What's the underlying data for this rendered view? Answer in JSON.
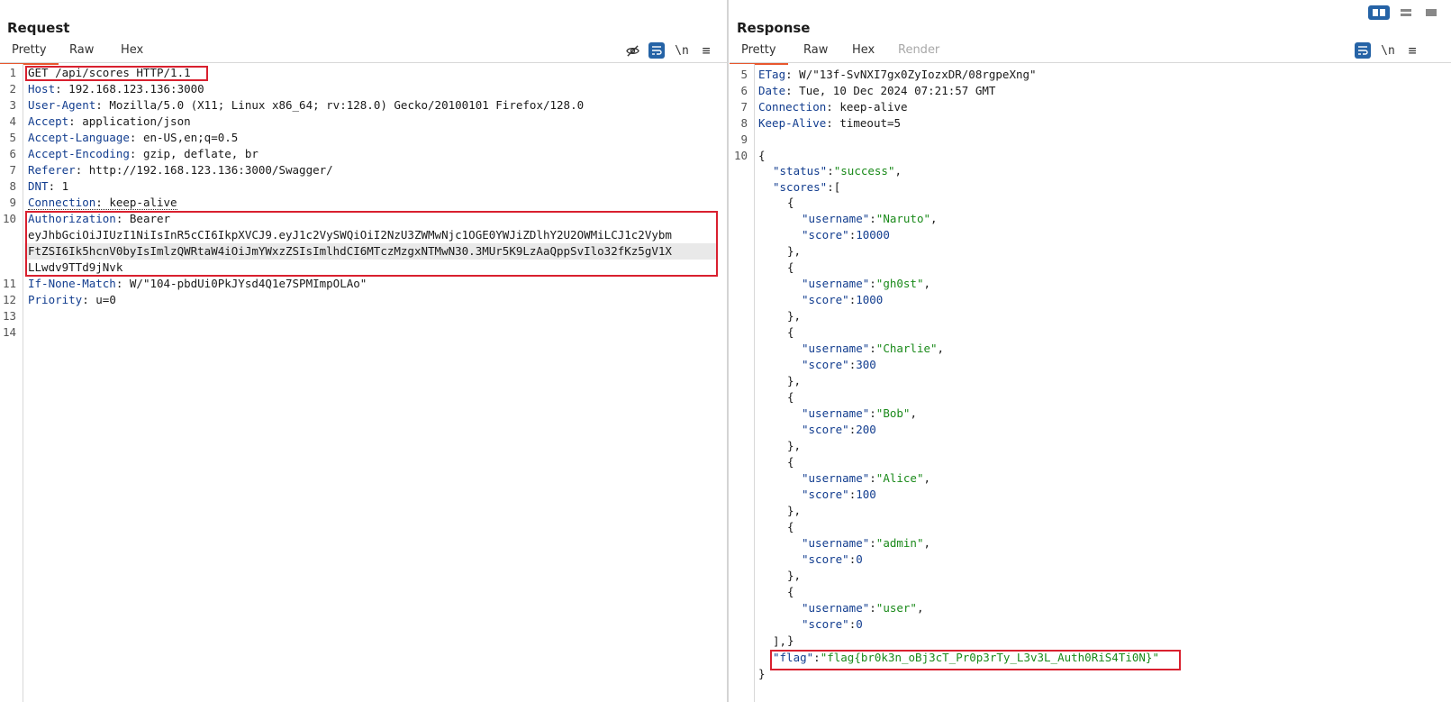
{
  "request": {
    "title": "Request",
    "tabs": [
      "Pretty",
      "Raw",
      "Hex"
    ],
    "active_tab": "Pretty",
    "toolbar": {
      "newline_label": "\\n",
      "menu_label": "≡"
    },
    "line_numbers": [
      "1",
      "2",
      "3",
      "4",
      "5",
      "6",
      "7",
      "8",
      "9",
      "10",
      "11",
      "12",
      "13",
      "14"
    ],
    "request_line": "GET /api/scores HTTP/1.1",
    "headers": [
      {
        "name": "Host",
        "value": " 192.168.123.136:3000"
      },
      {
        "name": "User-Agent",
        "value": " Mozilla/5.0 (X11; Linux x86_64; rv:128.0) Gecko/20100101 Firefox/128.0"
      },
      {
        "name": "Accept",
        "value": " application/json"
      },
      {
        "name": "Accept-Language",
        "value": " en-US,en;q=0.5"
      },
      {
        "name": "Accept-Encoding",
        "value": " gzip, deflate, br"
      },
      {
        "name": "Referer",
        "value": " http://192.168.123.136:3000/Swagger/"
      },
      {
        "name": "DNT",
        "value": " 1"
      },
      {
        "name": "Connection",
        "value": " keep-alive"
      }
    ],
    "auth": {
      "name": "Authorization",
      "value": " Bearer",
      "token_lines": [
        "eyJhbGciOiJIUzI1NiIsInR5cCI6IkpXVCJ9.eyJ1c2VySWQiOiI2NzU3ZWMwNjc1OGE0YWJiZDlhY2U2OWMiLCJ1c2Vybm",
        "FtZSI6Ik5hcnV0byIsImlzQWRtaW4iOiJmYWxzZSIsImlhdCI6MTczMzgxNTMwN30.3MUr5K9LzAaQppSvIlo32fKz5gV1X",
        "LLwdv9TTd9jNvk"
      ]
    },
    "after_headers": [
      {
        "name": "If-None-Match",
        "value": " W/\"104-pbdUi0PkJYsd4Q1e7SPMImpOLAo\""
      },
      {
        "name": "Priority",
        "value": " u=0"
      }
    ]
  },
  "response": {
    "title": "Response",
    "tabs": [
      "Pretty",
      "Raw",
      "Hex",
      "Render"
    ],
    "active_tab": "Pretty",
    "toolbar": {
      "newline_label": "\\n",
      "menu_label": "≡"
    },
    "line_numbers": [
      "5",
      "6",
      "7",
      "8",
      "9",
      "10"
    ],
    "headers": [
      {
        "name": "ETag",
        "value": " W/\"13f-SvNXI7gx0ZyIozxDR/08rgpeXng\""
      },
      {
        "name": "Date",
        "value": " Tue, 10 Dec 2024 07:21:57 GMT"
      },
      {
        "name": "Connection",
        "value": " keep-alive"
      },
      {
        "name": "Keep-Alive",
        "value": " timeout=5"
      }
    ],
    "json": {
      "open_brace": "{",
      "status_key": "\"status\"",
      "status_value": "\"success\"",
      "scores_key": "\"scores\"",
      "scores": [
        {
          "username": "\"Naruto\"",
          "score": "10000"
        },
        {
          "username": "\"gh0st\"",
          "score": "1000"
        },
        {
          "username": "\"Charlie\"",
          "score": "300"
        },
        {
          "username": "\"Bob\"",
          "score": "200"
        },
        {
          "username": "\"Alice\"",
          "score": "100"
        },
        {
          "username": "\"admin\"",
          "score": "0"
        },
        {
          "username": "\"user\"",
          "score": "0"
        }
      ],
      "username_key": "\"username\"",
      "score_key": "\"score\"",
      "flag_key": "\"flag\"",
      "flag_value": "\"flag{br0k3n_oBj3cT_Pr0p3rTy_L3v3L_Auth0RiS4Ti0N}\"",
      "close_brace": "}"
    }
  },
  "colors": {
    "accent": "#2563a6",
    "tab_underline": "#e8572e",
    "highlight_box": "#d9202f",
    "json_string": "#1a8a1a",
    "key": "#123d8f"
  }
}
